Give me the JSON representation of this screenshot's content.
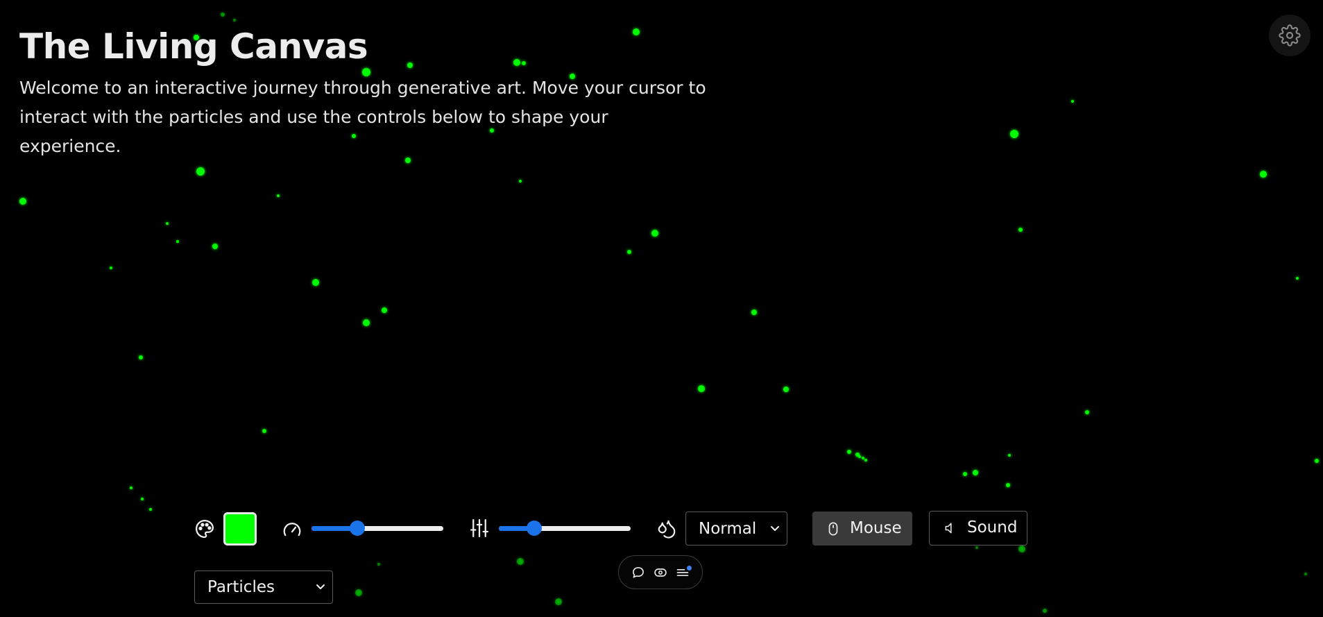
{
  "header": {
    "title": "The Living Canvas",
    "subtitle": "Welcome to an interactive journey through generative art. Move your cursor to interact with the particles and use the controls below to shape your experience."
  },
  "colors": {
    "background": "#000000",
    "particle": "#00ff00",
    "accent": "#1a73e8",
    "text": "#ececec"
  },
  "settings": {
    "icon": "gear-icon"
  },
  "controls": {
    "color": {
      "icon": "palette-icon",
      "value": "#00ff00"
    },
    "speed": {
      "icon": "gauge-icon",
      "value_fraction": 0.33
    },
    "density": {
      "icon": "sliders-icon",
      "value_fraction": 0.24
    },
    "blend": {
      "icon": "droplets-icon",
      "selected": "Normal"
    },
    "mouse_button": {
      "icon": "mouse-icon",
      "label": "Mouse",
      "active": true
    },
    "sound_button": {
      "icon": "speaker-icon",
      "label": "Sound",
      "active": false
    },
    "mode": {
      "selected": "Particles"
    }
  },
  "toolbar": {
    "items": [
      {
        "icon": "comment-icon"
      },
      {
        "icon": "eye-icon"
      },
      {
        "icon": "menu-icon",
        "has_badge": true
      }
    ]
  }
}
